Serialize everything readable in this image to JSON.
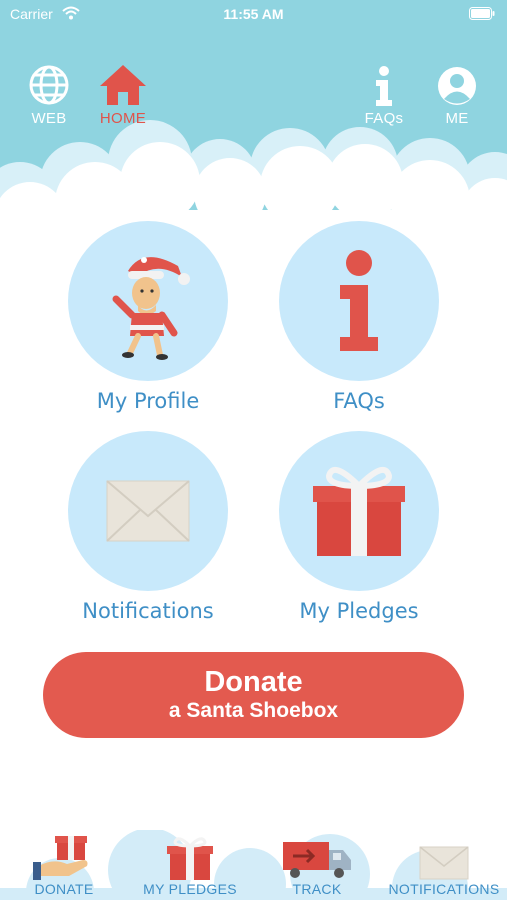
{
  "status_bar": {
    "carrier": "Carrier",
    "time": "11:55 AM"
  },
  "top_nav": {
    "web": {
      "label": "WEB",
      "icon": "globe-icon"
    },
    "home": {
      "label": "HOME",
      "icon": "house-icon",
      "active": true
    },
    "faqs": {
      "label": "FAQs",
      "icon": "info-icon"
    },
    "me": {
      "label": "ME",
      "icon": "person-icon"
    }
  },
  "tiles": {
    "profile": {
      "label": "My Profile",
      "icon": "santa-elf-icon"
    },
    "faqs": {
      "label": "FAQs",
      "icon": "info-icon"
    },
    "notifications": {
      "label": "Notifications",
      "icon": "envelope-icon"
    },
    "pledges": {
      "label": "My Pledges",
      "icon": "gift-icon"
    }
  },
  "donate_button": {
    "line1": "Donate",
    "line2": "a Santa Shoebox"
  },
  "tab_bar": {
    "donate": {
      "label": "DONATE",
      "icon": "hand-gift-icon"
    },
    "pledges": {
      "label": "MY PLEDGES",
      "icon": "gift-icon"
    },
    "track": {
      "label": "TRACK",
      "icon": "truck-icon"
    },
    "notifications": {
      "label": "NOTIFICATIONS",
      "icon": "envelope-icon"
    }
  },
  "colors": {
    "sky": "#8fd4e0",
    "accent_red": "#e35a4f",
    "tile_bg": "#c8e9fb",
    "label_blue": "#3f8fc6"
  }
}
